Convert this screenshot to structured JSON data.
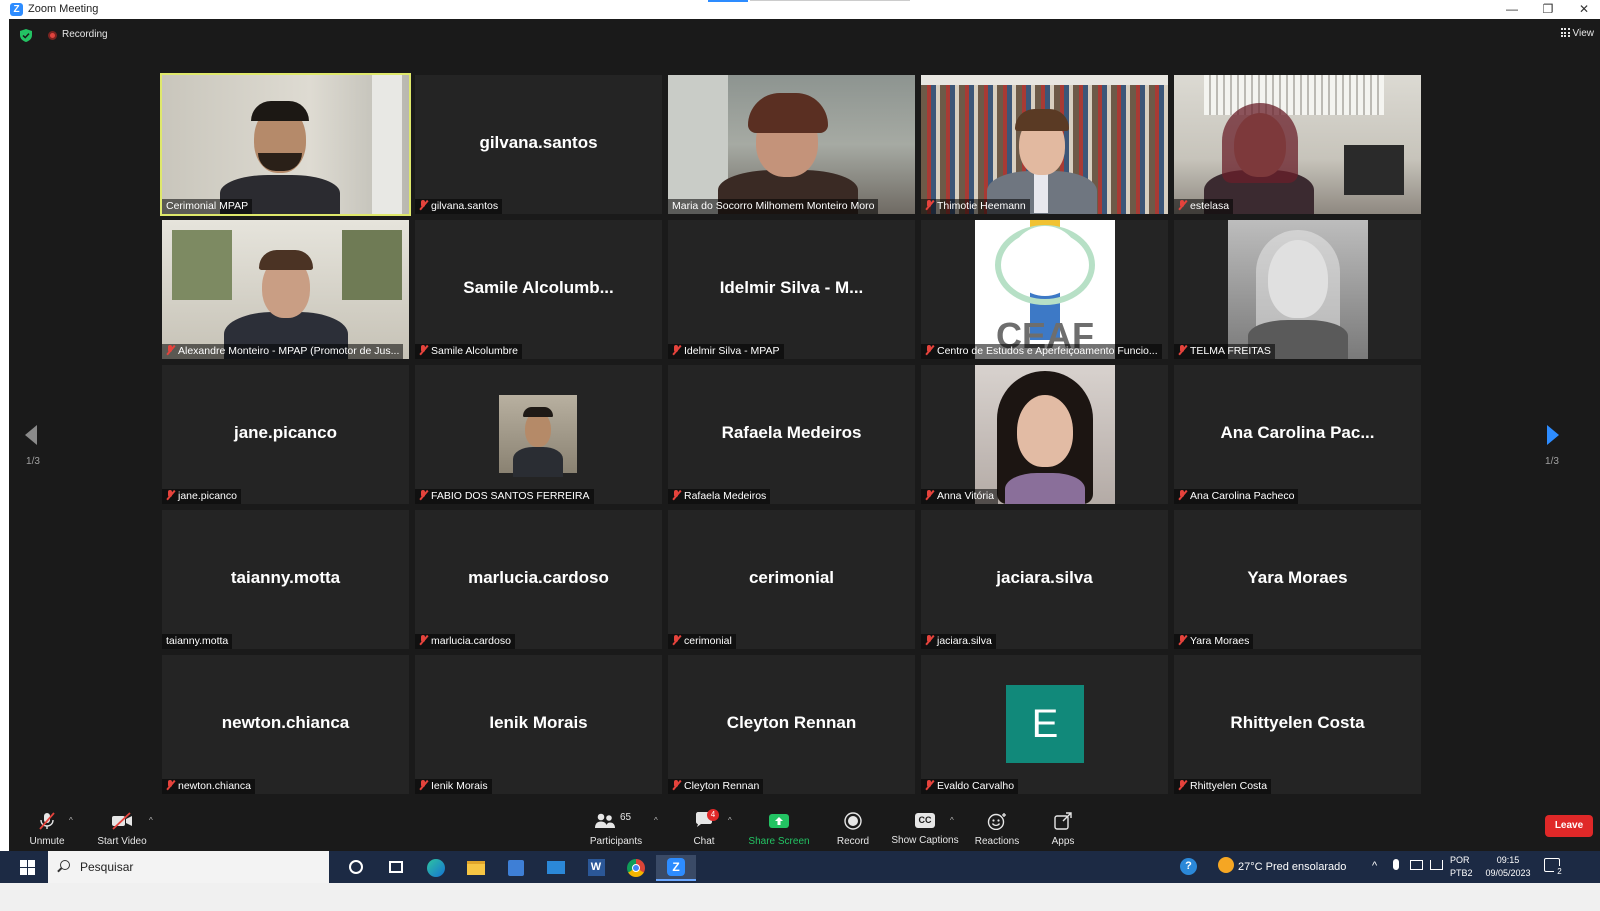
{
  "window": {
    "title": "Zoom Meeting",
    "minimize": "—",
    "restore": "❐",
    "close": "✕"
  },
  "status": {
    "recording_label": "Recording",
    "view_label": "View"
  },
  "pagination": {
    "left_label": "1/3",
    "right_label": "1/3"
  },
  "tiles": [
    {
      "display": "",
      "name": "Cerimonial MPAP",
      "muted": false,
      "video": true,
      "active": true
    },
    {
      "display": "gilvana.santos",
      "name": "gilvana.santos",
      "muted": true,
      "video": false
    },
    {
      "display": "",
      "name": "Maria do Socorro Milhomem Monteiro Moro",
      "muted": false,
      "video": true
    },
    {
      "display": "",
      "name": "Thimotie Heemann",
      "muted": true,
      "video": true
    },
    {
      "display": "",
      "name": "estelasa",
      "muted": true,
      "video": true
    },
    {
      "display": "",
      "name": "Alexandre Monteiro - MPAP (Promotor de Jus...",
      "muted": true,
      "video": true
    },
    {
      "display": "Samile  Alcolumb...",
      "name": "Samile Alcolumbre",
      "muted": true,
      "video": false
    },
    {
      "display": "Idelmir Silva - M...",
      "name": "Idelmir Silva - MPAP",
      "muted": true,
      "video": false
    },
    {
      "display": "",
      "name": "Centro de Estudos e Aperfeiçoamento Funcio...",
      "muted": true,
      "video": true
    },
    {
      "display": "",
      "name": "TELMA FREITAS",
      "muted": true,
      "video": true
    },
    {
      "display": "jane.picanco",
      "name": "jane.picanco",
      "muted": true,
      "video": false
    },
    {
      "display": "",
      "name": "FABIO DOS SANTOS FERREIRA",
      "muted": true,
      "video": false
    },
    {
      "display": "Rafaela Medeiros",
      "name": "Rafaela Medeiros",
      "muted": true,
      "video": false
    },
    {
      "display": "",
      "name": "Anna Vitória",
      "muted": true,
      "video": true
    },
    {
      "display": "Ana Carolina Pac...",
      "name": "Ana Carolina Pacheco",
      "muted": true,
      "video": false
    },
    {
      "display": "taianny.motta",
      "name": "taianny.motta",
      "muted": false,
      "video": false
    },
    {
      "display": "marlucia.cardoso",
      "name": "marlucia.cardoso",
      "muted": true,
      "video": false
    },
    {
      "display": "cerimonial",
      "name": "cerimonial",
      "muted": true,
      "video": false
    },
    {
      "display": "jaciara.silva",
      "name": "jaciara.silva",
      "muted": true,
      "video": false
    },
    {
      "display": "Yara Moraes",
      "name": "Yara Moraes",
      "muted": true,
      "video": false
    },
    {
      "display": "newton.chianca",
      "name": "newton.chianca",
      "muted": true,
      "video": false
    },
    {
      "display": "Ienik Morais",
      "name": "Ienik Morais",
      "muted": true,
      "video": false
    },
    {
      "display": "Cleyton Rennan",
      "name": "Cleyton Rennan",
      "muted": true,
      "video": false
    },
    {
      "display": "",
      "name": "Evaldo Carvalho",
      "muted": true,
      "video": false,
      "initial": "E"
    },
    {
      "display": "Rhittyelen Costa",
      "name": "Rhittyelen Costa",
      "muted": true,
      "video": false
    }
  ],
  "toolbar": {
    "unmute": "Unmute",
    "start_video": "Start Video",
    "participants": "Participants",
    "participant_count": "65",
    "chat": "Chat",
    "chat_badge": "4",
    "share_screen": "Share Screen",
    "record": "Record",
    "show_captions": "Show Captions",
    "captions_icon": "CC",
    "reactions": "Reactions",
    "apps": "Apps",
    "leave": "Leave"
  },
  "taskbar": {
    "search_placeholder": "Pesquisar",
    "weather": "27°C  Pred ensolarado",
    "lang_top": "POR",
    "lang_bottom": "PTB2",
    "time": "09:15",
    "date": "09/05/2023",
    "notification_count": "2"
  },
  "colors": {
    "meeting_bg": "#1a1a1a",
    "tile_bg": "#242424",
    "active_speaker": "#dfe86b",
    "muted_red": "#e5433c",
    "share_green": "#23c363",
    "leave_red": "#e02828",
    "zoom_blue": "#2d8cff",
    "avatar_teal": "#11897a"
  },
  "icons": [
    "zoom-logo-icon",
    "shield-icon",
    "record-dot-icon",
    "grid-view-icon",
    "arrow-left-icon",
    "arrow-right-icon",
    "mic-off-icon",
    "video-off-icon",
    "participants-icon",
    "chat-icon",
    "share-screen-icon",
    "record-icon",
    "captions-icon",
    "reactions-icon",
    "apps-icon",
    "windows-start-icon",
    "search-icon"
  ]
}
